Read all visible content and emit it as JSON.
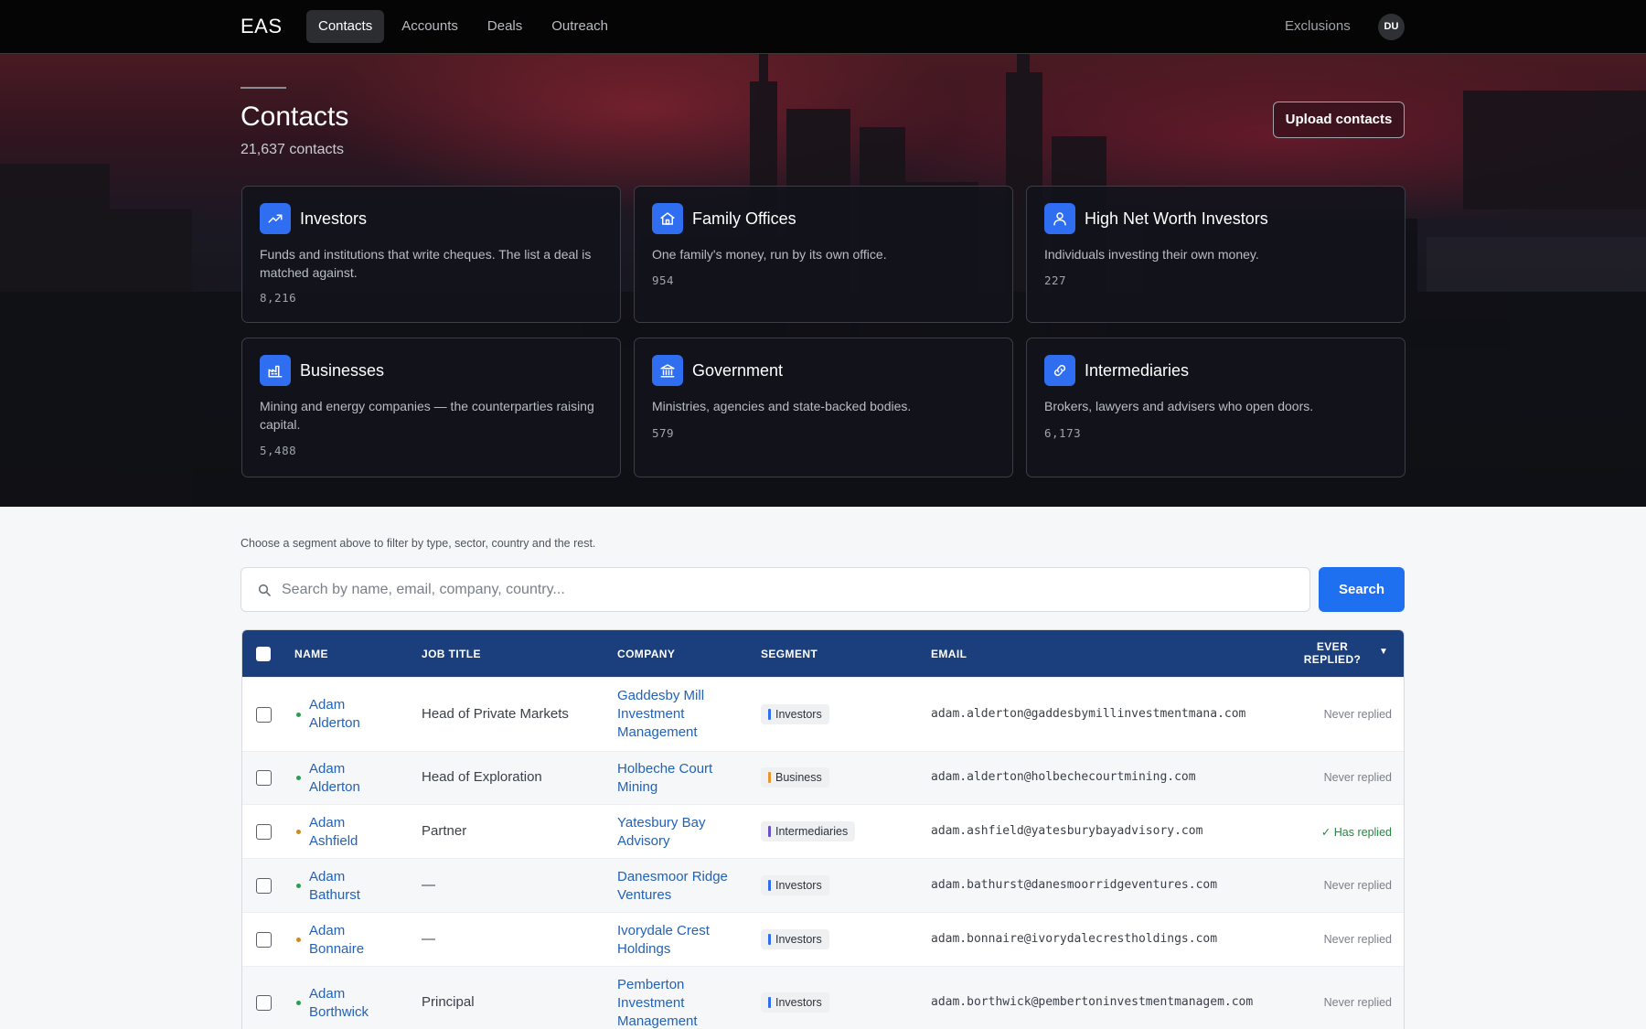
{
  "nav": {
    "brand": "EAS",
    "links": [
      "Contacts",
      "Accounts",
      "Deals",
      "Outreach"
    ],
    "active": "Contacts",
    "exclusions": "Exclusions",
    "avatar_initials": "DU"
  },
  "hero": {
    "title": "Contacts",
    "count": "21,637 contacts",
    "upload_label": "Upload contacts"
  },
  "segments": [
    {
      "title": "Investors",
      "desc": "Funds and institutions that write cheques. The list a deal is matched against.",
      "count": "8,216",
      "icon": "trending-up-icon"
    },
    {
      "title": "Family Offices",
      "desc": "One family's money, run by its own office.",
      "count": "954",
      "icon": "home-icon"
    },
    {
      "title": "High Net Worth Investors",
      "desc": "Individuals investing their own money.",
      "count": "227",
      "icon": "user-icon"
    },
    {
      "title": "Businesses",
      "desc": "Mining and energy companies — the counterparties raising capital.",
      "count": "5,488",
      "icon": "factory-icon"
    },
    {
      "title": "Government",
      "desc": "Ministries, agencies and state-backed bodies.",
      "count": "579",
      "icon": "government-building-icon"
    },
    {
      "title": "Intermediaries",
      "desc": "Brokers, lawyers and advisers who open doors.",
      "count": "6,173",
      "icon": "link-icon"
    }
  ],
  "filter_hint": "Choose a segment above to filter by type, sector, country and the rest.",
  "search": {
    "placeholder": "Search by name, email, company, country...",
    "button_label": "Search"
  },
  "table": {
    "headers": {
      "name": "NAME",
      "job_title": "JOB TITLE",
      "company": "COMPANY",
      "segment": "SEGMENT",
      "email": "EMAIL",
      "ever_replied_1": "EVER",
      "ever_replied_2": "REPLIED?",
      "sort": "▼"
    },
    "rows": [
      {
        "name1": "Adam",
        "name2": "Alderton",
        "job": "Head of Private Markets",
        "company": [
          "Gaddesby Mill",
          "Investment",
          "Management"
        ],
        "segment": "Investors",
        "email": "adam.alderton@gaddesbymillinvestmentmana.com",
        "replied": "Never replied",
        "status_color": "#2e9c52",
        "segment_color": "#2f6ef0"
      },
      {
        "name1": "Adam",
        "name2": "Alderton",
        "job": "Head of Exploration",
        "company": [
          "Holbeche Court",
          "Mining"
        ],
        "segment": "Business",
        "email": "adam.alderton@holbechecourtmining.com",
        "replied": "Never replied",
        "status_color": "#2e9c52",
        "segment_color": "#e8962c"
      },
      {
        "name1": "Adam",
        "name2": "Ashfield",
        "job": "Partner",
        "company": [
          "Yatesbury Bay",
          "Advisory"
        ],
        "segment": "Intermediaries",
        "email": "adam.ashfield@yatesburybayadvisory.com",
        "replied": "✓ Has replied",
        "status_color": "#d08a1c",
        "segment_color": "#6b4fc9"
      },
      {
        "name1": "Adam",
        "name2": "Bathurst",
        "job": "—",
        "company": [
          "Danesmoor Ridge",
          "Ventures"
        ],
        "segment": "Investors",
        "email": "adam.bathurst@danesmoorridgeventures.com",
        "replied": "Never replied",
        "status_color": "#2e9c52",
        "segment_color": "#2f6ef0"
      },
      {
        "name1": "Adam",
        "name2": "Bonnaire",
        "job": "—",
        "company": [
          "Ivorydale Crest",
          "Holdings"
        ],
        "segment": "Investors",
        "email": "adam.bonnaire@ivorydalecrestholdings.com",
        "replied": "Never replied",
        "status_color": "#d08a1c",
        "segment_color": "#2f6ef0"
      },
      {
        "name1": "Adam",
        "name2": "Borthwick",
        "job": "Principal",
        "company": [
          "Pemberton",
          "Investment",
          "Management"
        ],
        "segment": "Investors",
        "email": "adam.borthwick@pembertoninvestmentmanagem.com",
        "replied": "Never replied",
        "status_color": "#2e9c52",
        "segment_color": "#2f6ef0"
      }
    ]
  }
}
